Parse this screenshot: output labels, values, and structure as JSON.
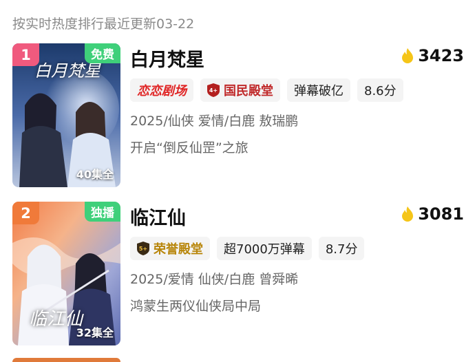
{
  "header": {
    "text": "按实时热度排行最近更新03-22"
  },
  "items": [
    {
      "rank": "1",
      "badge": "免费",
      "poster_title": "白月梵星",
      "episodes": "40集全",
      "title": "白月梵星",
      "hot": "3423",
      "tags": [
        "恋恋剧场",
        "国民殿堂",
        "弹幕破亿",
        "8.6分"
      ],
      "meta": "2025/仙侠 爱情/白鹿 敖瑞鹏",
      "desc": "开启“倒反仙罡”之旅"
    },
    {
      "rank": "2",
      "badge": "独播",
      "poster_title": "临江仙",
      "episodes": "32集全",
      "title": "临江仙",
      "hot": "3081",
      "tags": [
        "荣誉殿堂",
        "超7000万弹幕",
        "8.7分"
      ],
      "meta": "2025/爱情 仙侠/白鹿 曾舜晞",
      "desc": "鸿蒙生两仪仙侠局中局"
    }
  ],
  "colors": {
    "rank1": "#f05a7e",
    "rank2": "#f07a3a",
    "badge_bg": "#3fd07a",
    "flame": "#f5c518",
    "shield_red": "#b3201f",
    "shield_gold": "#3a2a14"
  },
  "icons": {
    "hot": "flame-icon"
  }
}
